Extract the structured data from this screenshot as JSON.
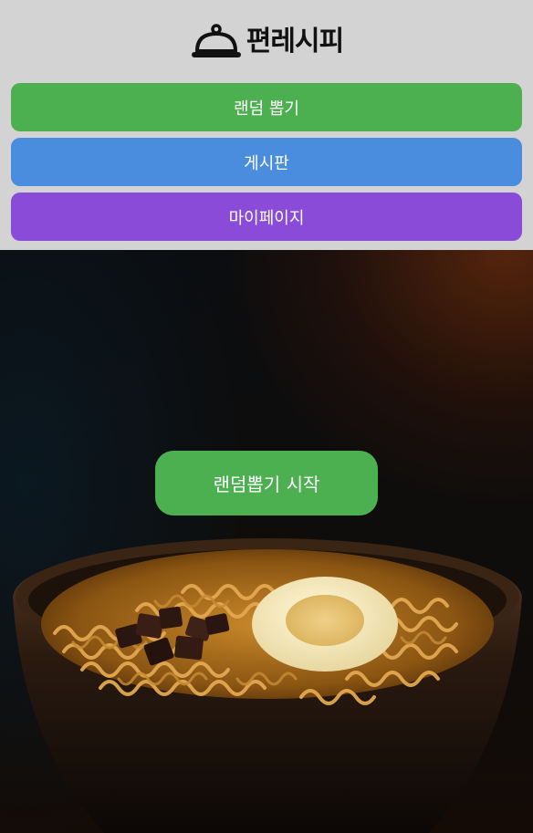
{
  "app": {
    "title": "편레시피",
    "logo_icon": "cloche-icon"
  },
  "nav": {
    "random_label": "랜덤 뽑기",
    "board_label": "게시판",
    "mypage_label": "마이페이지"
  },
  "hero": {
    "start_label": "랜덤뽑기 시작",
    "image": "ramen-bowl-image"
  },
  "colors": {
    "green": "#4caf50",
    "blue": "#4a8ddf",
    "purple": "#8a4bd8",
    "header_bg": "#d3d3d3"
  }
}
